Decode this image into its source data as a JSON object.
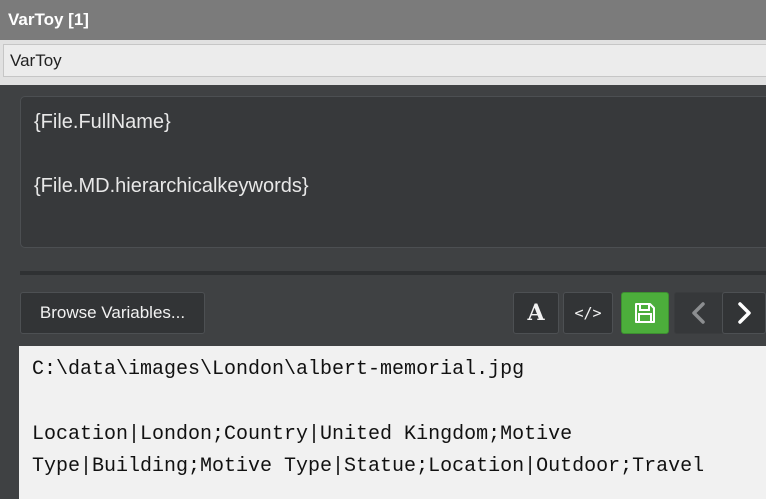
{
  "window": {
    "title": "VarToy [1]"
  },
  "tab": {
    "label": "VarToy"
  },
  "editor": {
    "lines": [
      "{File.FullName}",
      "{File.MD.hierarchicalkeywords}"
    ]
  },
  "toolbar": {
    "browse_label": "Browse Variables...",
    "font_glyph": "A",
    "code_glyph": "</>",
    "icons": {
      "font": "font-icon",
      "code": "code-icon",
      "save": "save-icon",
      "prev": "chevron-left-icon",
      "next": "chevron-right-icon"
    },
    "colors": {
      "save_bg": "#4cae3b"
    }
  },
  "output": {
    "lines": [
      "C:\\data\\images\\London\\albert-memorial.jpg",
      "Location|London;Country|United Kingdom;Motive",
      "Type|Building;Motive Type|Statue;Location|Outdoor;Travel"
    ]
  }
}
